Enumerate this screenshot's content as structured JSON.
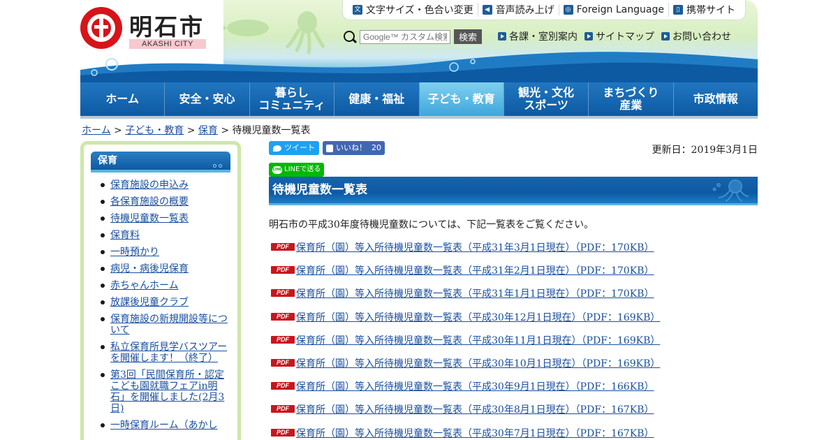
{
  "header": {
    "logo_kanji": "明石市",
    "logo_en": "AKASHI CITY",
    "util_links": [
      {
        "icon": "text-size-icon",
        "label": "文字サイズ・色合い変更"
      },
      {
        "icon": "speaker-icon",
        "label": "音声読み上げ"
      },
      {
        "icon": "globe-icon",
        "label": "Foreign Language"
      },
      {
        "icon": "mobile-icon",
        "label": "携帯サイト"
      }
    ],
    "search": {
      "placeholder": "Google™ カスタム検索",
      "button": "検索"
    },
    "sub_links": [
      "各課・室別案内",
      "サイトマップ",
      "お問い合わせ"
    ]
  },
  "gnav": [
    {
      "label": "ホーム",
      "active": false
    },
    {
      "label": "安全・安心",
      "active": false
    },
    {
      "label": "暮らし\nコミュニティ",
      "active": false
    },
    {
      "label": "健康・福祉",
      "active": false
    },
    {
      "label": "子ども・教育",
      "active": true
    },
    {
      "label": "観光・文化\nスポーツ",
      "active": false
    },
    {
      "label": "まちづくり\n産業",
      "active": false
    },
    {
      "label": "市政情報",
      "active": false
    }
  ],
  "breadcrumb": {
    "links": [
      "ホーム",
      "子ども・教育",
      "保育"
    ],
    "separator": ">",
    "current": "待機児童数一覧表"
  },
  "sidebar": {
    "heading": "保育",
    "items": [
      "保育施設の申込み",
      "各保育施設の概要",
      "待機児童数一覧表",
      "保育料",
      "一時預かり",
      "病児・病後児保育",
      "赤ちゃんホーム",
      "放課後児童クラブ",
      "保育施設の新規開設等について",
      "私立保育所見学バスツアーを開催します！（終了）",
      "第3回「民間保育所・認定こども園就職フェアin明石」を開催しました(2月3日)",
      "一時保育ルーム（あかし"
    ]
  },
  "social": {
    "tweet": "ツイート",
    "like": "いいね！",
    "like_count": "20",
    "line": "LINEで送る",
    "line_logo": "LINE"
  },
  "updated": "更新日：2019年3月1日",
  "page_title": "待機児童数一覧表",
  "intro": "明石市の平成30年度待機児童数については、下記一覧表をご覧ください。",
  "pdf_badge": "PDF",
  "pdf_links": [
    "保育所（園）等入所待機児童数一覧表（平成31年3月1日現在）（PDF：170KB）",
    "保育所（園）等入所待機児童数一覧表（平成31年2月1日現在）（PDF：170KB）",
    "保育所（園）等入所待機児童数一覧表（平成31年1月1日現在）（PDF：170KB）",
    "保育所（園）等入所待機児童数一覧表（平成30年12月1日現在）（PDF：169KB）",
    "保育所（園）等入所待機児童数一覧表（平成30年11月1日現在）（PDF：169KB）",
    "保育所（園）等入所待機児童数一覧表（平成30年10月1日現在）（PDF：169KB）",
    "保育所（園）等入所待機児童数一覧表（平成30年9月1日現在）（PDF：166KB）",
    "保育所（園）等入所待機児童数一覧表（平成30年8月1日現在）（PDF：167KB）",
    "保育所（園）等入所待機児童数一覧表（平成30年7月1日現在）（PDF：167KB）"
  ],
  "colors": {
    "nav_blue": "#0d5aa3",
    "nav_active": "#3fa6dc",
    "sidebar_border": "#cde8a8",
    "link": "#1a4fa0",
    "pdf_red": "#c8161d"
  }
}
